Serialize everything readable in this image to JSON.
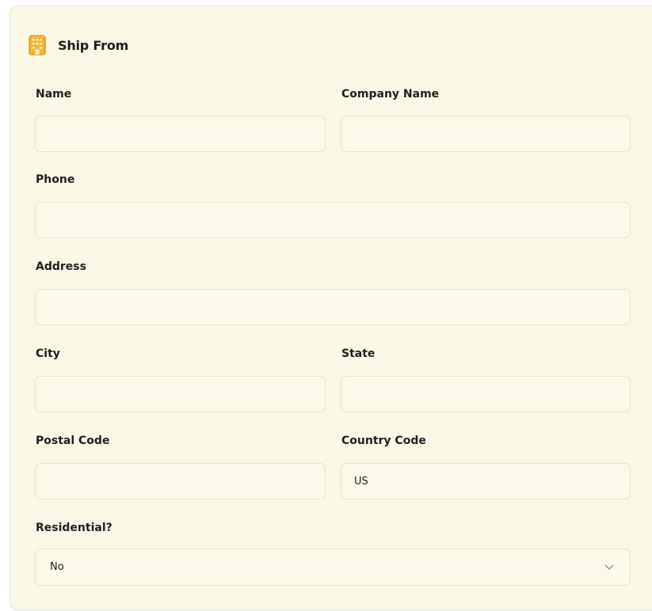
{
  "section": {
    "title": "Ship From",
    "icon": "building-icon",
    "accent": "#f2b233"
  },
  "fields": {
    "name": {
      "label": "Name",
      "value": ""
    },
    "company_name": {
      "label": "Company Name",
      "value": ""
    },
    "phone": {
      "label": "Phone",
      "value": ""
    },
    "address": {
      "label": "Address",
      "value": ""
    },
    "city": {
      "label": "City",
      "value": ""
    },
    "state": {
      "label": "State",
      "value": ""
    },
    "postal_code": {
      "label": "Postal Code",
      "value": ""
    },
    "country_code": {
      "label": "Country Code",
      "value": "US"
    },
    "residential": {
      "label": "Residential?",
      "selected": "No"
    }
  },
  "colors": {
    "card_background": "#fbf8e6",
    "field_border": "#e6e2cf",
    "text": "#1f1f1f"
  }
}
